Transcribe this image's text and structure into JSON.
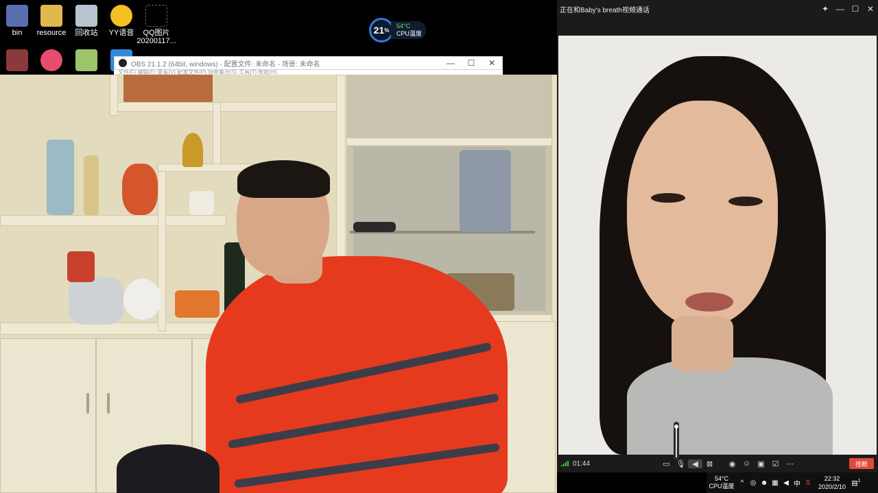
{
  "desktop": {
    "icons": [
      {
        "label": "bin",
        "icon": "bin-folder-icon",
        "color": "#5b6fb0"
      },
      {
        "label": "resource",
        "icon": "folder-icon",
        "color": "#e0b84e"
      },
      {
        "label": "回收站",
        "icon": "recycle-bin-icon",
        "color": "#b7c3cf"
      },
      {
        "label": "YY语音",
        "icon": "yy-voice-icon",
        "color": "#f2c024"
      },
      {
        "label": "QQ图片\n20200117...",
        "icon": "image-file-icon",
        "color": "#dddddd"
      }
    ],
    "icons_row2": [
      {
        "label": "",
        "icon": "game-avatar-icon",
        "color": "#8a3a3a"
      },
      {
        "label": "",
        "icon": "app-99-icon",
        "color": "#e84c6c"
      },
      {
        "label": "",
        "icon": "user-app-icon",
        "color": "#9bc46b"
      },
      {
        "label": "",
        "icon": "blue-app-icon",
        "color": "#2f8ad8"
      },
      {
        "label": "",
        "icon": "file-icon",
        "color": "#dddddd"
      }
    ]
  },
  "cpu_widget": {
    "usage": "21",
    "usage_unit": "%",
    "temp": "54°C",
    "label": "CPU温度"
  },
  "obs": {
    "title": "OBS 21.1.2 (64bit, windows) - 配置文件: 未命名 - 场景: 未命名",
    "minimize": "—",
    "maximize": "☐",
    "close": "✕",
    "menu": "文件(F)   编辑(E)   查看(V)   配置文件(P)   场景集合(S)   工具(T)   帮助(H)"
  },
  "video_call": {
    "title": "正在和Baby's breath视频通话",
    "pin": "✦",
    "minimize": "—",
    "maximize": "☐",
    "close": "✕",
    "timer": "01:44",
    "hangup": "挂断",
    "controls": [
      "chat-icon",
      "microphone-icon",
      "speaker-icon",
      "camera-off-icon",
      "screenshot-icon",
      "effects-icon",
      "screen-share-icon",
      "whiteboard-icon",
      "more-icon"
    ],
    "volume_level": 0.95
  },
  "tray": {
    "temp": "54°C",
    "temp_label": "CPU温度",
    "chevron": "^",
    "ime": "中",
    "time": "22:32",
    "date": "2020/2/10",
    "notifications": "1"
  }
}
